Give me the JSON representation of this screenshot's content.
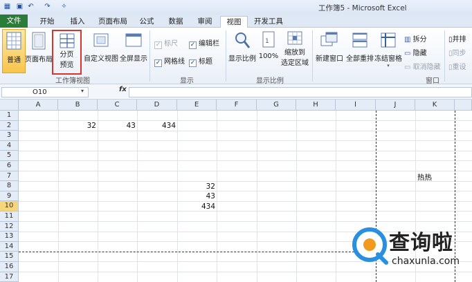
{
  "window": {
    "title": "工作簿5 - Microsoft Excel"
  },
  "tabs": [
    {
      "label": "文件"
    },
    {
      "label": "开始"
    },
    {
      "label": "插入"
    },
    {
      "label": "页面布局"
    },
    {
      "label": "公式"
    },
    {
      "label": "数据"
    },
    {
      "label": "审阅"
    },
    {
      "label": "视图"
    },
    {
      "label": "开发工具"
    }
  ],
  "ribbon": {
    "workbook_views": {
      "normal": "普通",
      "page_layout": "页面布局",
      "page_break_line1": "分页",
      "page_break_line2": "预览",
      "custom_views": "自定义视图",
      "full_screen": "全屏显示",
      "group_label": "工作簿视图"
    },
    "show": {
      "ruler": "标尺",
      "formula_bar": "编辑栏",
      "gridlines": "网格线",
      "headings": "标题",
      "group_label": "显示"
    },
    "zoom": {
      "zoom": "显示比例",
      "zoom_100": "100%",
      "zoom_selection_line1": "缩放到",
      "zoom_selection_line2": "选定区域",
      "group_label": "显示比例"
    },
    "window": {
      "new_window": "新建窗口",
      "arrange_all": "全部重排",
      "freeze_panes": "冻结窗格",
      "split": "拆分",
      "hide": "隐藏",
      "unhide": "取消隐藏",
      "group_label": "窗口"
    },
    "right_partial": {
      "side_by_side": "并排",
      "sync_scroll": "同步",
      "reset": "重设"
    }
  },
  "formula_bar": {
    "name_box": "O10",
    "fx": "fx",
    "content": ""
  },
  "grid": {
    "columns": [
      "A",
      "B",
      "C",
      "D",
      "E",
      "F",
      "G",
      "H",
      "I",
      "J",
      "K"
    ],
    "rows": [
      "1",
      "2",
      "3",
      "4",
      "5",
      "6",
      "7",
      "8",
      "9",
      "10",
      "11",
      "12",
      "13",
      "14",
      "15",
      "16",
      "17"
    ],
    "selected_row": "10",
    "cells": {
      "B2": "32",
      "C2": "43",
      "D2": "434",
      "J7": "热热",
      "E8": "32",
      "E9": "43",
      "E10": "434"
    }
  },
  "watermark": {
    "text": "查询啦",
    "url": "chaxunla.com"
  },
  "colors": {
    "file_tab": "#2a7d38",
    "highlight_box": "#d9342b",
    "selected_row": "#f7d67b",
    "normal_active": "#f8c54a"
  }
}
